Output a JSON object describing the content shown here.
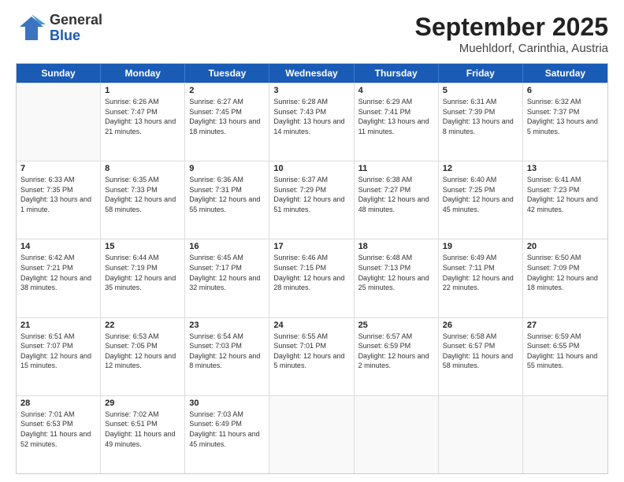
{
  "header": {
    "logo_general": "General",
    "logo_blue": "Blue",
    "title": "September 2025",
    "subtitle": "Muehldorf, Carinthia, Austria"
  },
  "weekdays": [
    "Sunday",
    "Monday",
    "Tuesday",
    "Wednesday",
    "Thursday",
    "Friday",
    "Saturday"
  ],
  "rows": [
    [
      {
        "day": "",
        "sunrise": "",
        "sunset": "",
        "daylight": ""
      },
      {
        "day": "1",
        "sunrise": "Sunrise: 6:26 AM",
        "sunset": "Sunset: 7:47 PM",
        "daylight": "Daylight: 13 hours and 21 minutes."
      },
      {
        "day": "2",
        "sunrise": "Sunrise: 6:27 AM",
        "sunset": "Sunset: 7:45 PM",
        "daylight": "Daylight: 13 hours and 18 minutes."
      },
      {
        "day": "3",
        "sunrise": "Sunrise: 6:28 AM",
        "sunset": "Sunset: 7:43 PM",
        "daylight": "Daylight: 13 hours and 14 minutes."
      },
      {
        "day": "4",
        "sunrise": "Sunrise: 6:29 AM",
        "sunset": "Sunset: 7:41 PM",
        "daylight": "Daylight: 13 hours and 11 minutes."
      },
      {
        "day": "5",
        "sunrise": "Sunrise: 6:31 AM",
        "sunset": "Sunset: 7:39 PM",
        "daylight": "Daylight: 13 hours and 8 minutes."
      },
      {
        "day": "6",
        "sunrise": "Sunrise: 6:32 AM",
        "sunset": "Sunset: 7:37 PM",
        "daylight": "Daylight: 13 hours and 5 minutes."
      }
    ],
    [
      {
        "day": "7",
        "sunrise": "Sunrise: 6:33 AM",
        "sunset": "Sunset: 7:35 PM",
        "daylight": "Daylight: 13 hours and 1 minute."
      },
      {
        "day": "8",
        "sunrise": "Sunrise: 6:35 AM",
        "sunset": "Sunset: 7:33 PM",
        "daylight": "Daylight: 12 hours and 58 minutes."
      },
      {
        "day": "9",
        "sunrise": "Sunrise: 6:36 AM",
        "sunset": "Sunset: 7:31 PM",
        "daylight": "Daylight: 12 hours and 55 minutes."
      },
      {
        "day": "10",
        "sunrise": "Sunrise: 6:37 AM",
        "sunset": "Sunset: 7:29 PM",
        "daylight": "Daylight: 12 hours and 51 minutes."
      },
      {
        "day": "11",
        "sunrise": "Sunrise: 6:38 AM",
        "sunset": "Sunset: 7:27 PM",
        "daylight": "Daylight: 12 hours and 48 minutes."
      },
      {
        "day": "12",
        "sunrise": "Sunrise: 6:40 AM",
        "sunset": "Sunset: 7:25 PM",
        "daylight": "Daylight: 12 hours and 45 minutes."
      },
      {
        "day": "13",
        "sunrise": "Sunrise: 6:41 AM",
        "sunset": "Sunset: 7:23 PM",
        "daylight": "Daylight: 12 hours and 42 minutes."
      }
    ],
    [
      {
        "day": "14",
        "sunrise": "Sunrise: 6:42 AM",
        "sunset": "Sunset: 7:21 PM",
        "daylight": "Daylight: 12 hours and 38 minutes."
      },
      {
        "day": "15",
        "sunrise": "Sunrise: 6:44 AM",
        "sunset": "Sunset: 7:19 PM",
        "daylight": "Daylight: 12 hours and 35 minutes."
      },
      {
        "day": "16",
        "sunrise": "Sunrise: 6:45 AM",
        "sunset": "Sunset: 7:17 PM",
        "daylight": "Daylight: 12 hours and 32 minutes."
      },
      {
        "day": "17",
        "sunrise": "Sunrise: 6:46 AM",
        "sunset": "Sunset: 7:15 PM",
        "daylight": "Daylight: 12 hours and 28 minutes."
      },
      {
        "day": "18",
        "sunrise": "Sunrise: 6:48 AM",
        "sunset": "Sunset: 7:13 PM",
        "daylight": "Daylight: 12 hours and 25 minutes."
      },
      {
        "day": "19",
        "sunrise": "Sunrise: 6:49 AM",
        "sunset": "Sunset: 7:11 PM",
        "daylight": "Daylight: 12 hours and 22 minutes."
      },
      {
        "day": "20",
        "sunrise": "Sunrise: 6:50 AM",
        "sunset": "Sunset: 7:09 PM",
        "daylight": "Daylight: 12 hours and 18 minutes."
      }
    ],
    [
      {
        "day": "21",
        "sunrise": "Sunrise: 6:51 AM",
        "sunset": "Sunset: 7:07 PM",
        "daylight": "Daylight: 12 hours and 15 minutes."
      },
      {
        "day": "22",
        "sunrise": "Sunrise: 6:53 AM",
        "sunset": "Sunset: 7:05 PM",
        "daylight": "Daylight: 12 hours and 12 minutes."
      },
      {
        "day": "23",
        "sunrise": "Sunrise: 6:54 AM",
        "sunset": "Sunset: 7:03 PM",
        "daylight": "Daylight: 12 hours and 8 minutes."
      },
      {
        "day": "24",
        "sunrise": "Sunrise: 6:55 AM",
        "sunset": "Sunset: 7:01 PM",
        "daylight": "Daylight: 12 hours and 5 minutes."
      },
      {
        "day": "25",
        "sunrise": "Sunrise: 6:57 AM",
        "sunset": "Sunset: 6:59 PM",
        "daylight": "Daylight: 12 hours and 2 minutes."
      },
      {
        "day": "26",
        "sunrise": "Sunrise: 6:58 AM",
        "sunset": "Sunset: 6:57 PM",
        "daylight": "Daylight: 11 hours and 58 minutes."
      },
      {
        "day": "27",
        "sunrise": "Sunrise: 6:59 AM",
        "sunset": "Sunset: 6:55 PM",
        "daylight": "Daylight: 11 hours and 55 minutes."
      }
    ],
    [
      {
        "day": "28",
        "sunrise": "Sunrise: 7:01 AM",
        "sunset": "Sunset: 6:53 PM",
        "daylight": "Daylight: 11 hours and 52 minutes."
      },
      {
        "day": "29",
        "sunrise": "Sunrise: 7:02 AM",
        "sunset": "Sunset: 6:51 PM",
        "daylight": "Daylight: 11 hours and 49 minutes."
      },
      {
        "day": "30",
        "sunrise": "Sunrise: 7:03 AM",
        "sunset": "Sunset: 6:49 PM",
        "daylight": "Daylight: 11 hours and 45 minutes."
      },
      {
        "day": "",
        "sunrise": "",
        "sunset": "",
        "daylight": ""
      },
      {
        "day": "",
        "sunrise": "",
        "sunset": "",
        "daylight": ""
      },
      {
        "day": "",
        "sunrise": "",
        "sunset": "",
        "daylight": ""
      },
      {
        "day": "",
        "sunrise": "",
        "sunset": "",
        "daylight": ""
      }
    ]
  ]
}
